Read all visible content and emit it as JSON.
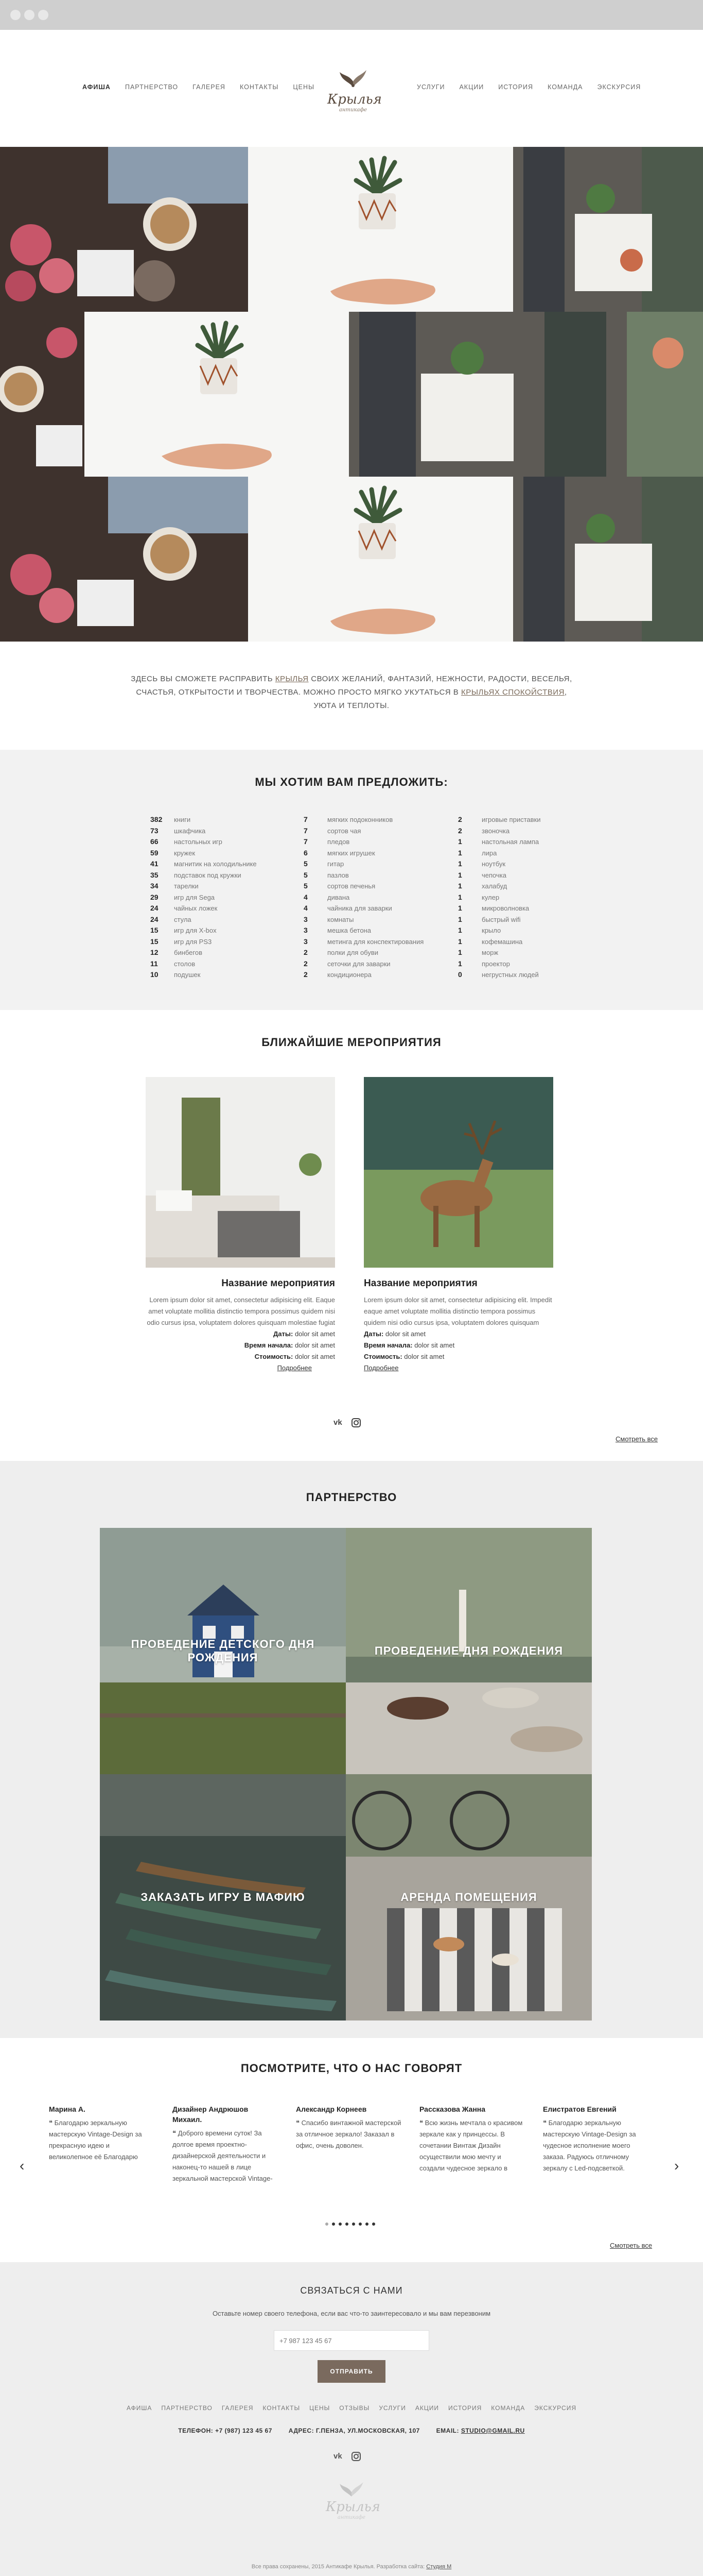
{
  "nav": {
    "left": [
      "Афиша",
      "Партнерство",
      "Галерея",
      "Контакты",
      "Цены"
    ],
    "right": [
      "Услуги",
      "Акции",
      "История",
      "Команда",
      "Экскурсия"
    ],
    "active": "Афиша"
  },
  "logo": {
    "name": "Крылья",
    "tagline": "антикафе"
  },
  "intro": {
    "part1": "Здесь вы сможете расправить ",
    "link1": "крылья",
    "part2": " своих желаний, фантазий, нежности, радости, веселья, счастья, открытости и творчества. Можно просто мягко укутаться в ",
    "link2": "крыльях спокойствия",
    "part3": ", уюта и теплоты."
  },
  "offer": {
    "title": "Мы хотим вам предложить:",
    "columns": [
      [
        {
          "n": "382",
          "t": "книги"
        },
        {
          "n": "73",
          "t": "шкафчика"
        },
        {
          "n": "66",
          "t": "настольных игр"
        },
        {
          "n": "59",
          "t": "кружек"
        },
        {
          "n": "41",
          "t": "магнитик на холодильнике"
        },
        {
          "n": "35",
          "t": "подставок под кружки"
        },
        {
          "n": "34",
          "t": "тарелки"
        },
        {
          "n": "29",
          "t": "игр для Sega"
        },
        {
          "n": "24",
          "t": "чайных ложек"
        },
        {
          "n": "24",
          "t": "стула"
        },
        {
          "n": "15",
          "t": "игр для X-box"
        },
        {
          "n": "15",
          "t": "игр для PS3"
        },
        {
          "n": "12",
          "t": "бинбегов"
        },
        {
          "n": "11",
          "t": "столов"
        },
        {
          "n": "10",
          "t": "подушек"
        }
      ],
      [
        {
          "n": "7",
          "t": "мягких подоконников"
        },
        {
          "n": "7",
          "t": "сортов чая"
        },
        {
          "n": "7",
          "t": "пледов"
        },
        {
          "n": "6",
          "t": "мягких игрушек"
        },
        {
          "n": "5",
          "t": "гитар"
        },
        {
          "n": "5",
          "t": "пазлов"
        },
        {
          "n": "5",
          "t": "сортов печенья"
        },
        {
          "n": "4",
          "t": "дивана"
        },
        {
          "n": "4",
          "t": "чайника для заварки"
        },
        {
          "n": "3",
          "t": "комнаты"
        },
        {
          "n": "3",
          "t": "мешка бетона"
        },
        {
          "n": "3",
          "t": "метинга для конспектирования"
        },
        {
          "n": "2",
          "t": "полки для обуви"
        },
        {
          "n": "2",
          "t": "сеточки для заварки"
        },
        {
          "n": "2",
          "t": "кондиционера"
        }
      ],
      [
        {
          "n": "2",
          "t": "игровые приставки"
        },
        {
          "n": "2",
          "t": "звоночка"
        },
        {
          "n": "1",
          "t": "настольная лампа"
        },
        {
          "n": "1",
          "t": "лира"
        },
        {
          "n": "1",
          "t": "ноутбук"
        },
        {
          "n": "1",
          "t": "чепочка"
        },
        {
          "n": "1",
          "t": "халабуд"
        },
        {
          "n": "1",
          "t": "кулер"
        },
        {
          "n": "1",
          "t": "микроволновка"
        },
        {
          "n": "1",
          "t": "быстрый wifi"
        },
        {
          "n": "1",
          "t": "крыло"
        },
        {
          "n": "1",
          "t": "кофемашина"
        },
        {
          "n": "1",
          "t": "морж"
        },
        {
          "n": "1",
          "t": "проектор"
        },
        {
          "n": "0",
          "t": "негрустных людей"
        }
      ]
    ]
  },
  "events": {
    "title": "Ближайшие мероприятия",
    "items": [
      {
        "name": "Название мероприятия",
        "desc": "Lorem ipsum dolor sit amet, consectetur adipisicing elit. Eaque amet voluptate mollitia distinctio tempora possimus quidem nisi odio cursus ipsa, voluptatem dolores quisquam molestiae fugiat vero eum atque fuga",
        "dates_label": "Даты:",
        "dates": "dolor sit amet",
        "start_label": "Время начала:",
        "start": "dolor sit amet",
        "price_label": "Стоимость:",
        "price": "dolor sit amet",
        "more": "Подробнее"
      },
      {
        "name": "Название мероприятия",
        "desc": "Lorem ipsum dolor sit amet, consectetur adipisicing elit. Impedit eaque amet voluptate mollitia distinctio tempora possimus quidem nisi odio cursus ipsa, voluptatem dolores quisquam molestiae fugiat vero",
        "dates_label": "Даты:",
        "dates": "dolor sit amet",
        "start_label": "Время начала:",
        "start": "dolor sit amet",
        "price_label": "Стоимость:",
        "price": "dolor sit amet",
        "more": "Подробнее"
      }
    ],
    "view_all": "Смотреть все"
  },
  "partnership": {
    "title": "Партнерство",
    "tiles": [
      "Проведение детского дня рождения",
      "Проведение дня рождения",
      "Заказать игру в мафию",
      "Аренда помещения"
    ]
  },
  "reviews": {
    "title": "Посмотрите, что о нас говорят",
    "items": [
      {
        "name": "Марина А.",
        "text": "❝ Благодарю зеркальную мастерскую Vintage-Design за прекрасную идею и великолепное её Благодарю зеркальную мастерскую Vintage-Design за прекрасную"
      },
      {
        "name": "Дизайнер Андрюшов Михаил.",
        "text": "❝ Доброго времени суток! За долгое время проектно-дизайнерской деятельности и наконец-то нашей в лице зеркальной мастерской Vintage-Design надежного партнера"
      },
      {
        "name": "Александр Корнеев",
        "text": "❝ Спасибо винтажной мастерской за отличное зеркало! Заказал в офис, очень доволен."
      },
      {
        "name": "Рассказова Жанна",
        "text": "❝ Всю жизнь мечтала о красивом зеркале как у принцессы. В сочетании Винтаж Дизайн осуществили мою мечту и создали чудесное зеркало в состаренном стиле! Обязательно"
      },
      {
        "name": "Елистратов Евгений",
        "text": "❝ Благодарю зеркальную мастерскую Vintage-Design за чудесное исполнение моего заказа. Радуюсь отличному зеркалу с Led-подсветкой. Спасибо, друзья"
      }
    ],
    "prev": "‹",
    "next": "›",
    "dots_count": 8,
    "view_all": "Смотреть все"
  },
  "contact": {
    "title": "Связаться с нами",
    "subtitle": "Оставьте номер своего телефона, если вас что-то заинтересовало и мы вам перезвоним",
    "phone_placeholder": "+7 987 123 45 67",
    "send": "Отправить"
  },
  "footer": {
    "nav": [
      "Афиша",
      "Партнерство",
      "Галерея",
      "Контакты",
      "Цены",
      "Отзывы",
      "Услуги",
      "Акции",
      "История",
      "Команда",
      "Экскурсия"
    ],
    "phone_label": "Телефон:",
    "phone": "+7 (987) 123 45 67",
    "address_label": "Адрес:",
    "address": "г.Пенза, ул.Московская, 107",
    "email_label": "Email:",
    "email": "studio@gmail.ru",
    "copyright_text": "Все права сохранены, 2015 Антикафе Крылья. Разработка сайта: ",
    "copyright_link": "Студия М"
  },
  "colors": {
    "accent": "#7a6a5e",
    "section_bg": "#eeeeee"
  }
}
